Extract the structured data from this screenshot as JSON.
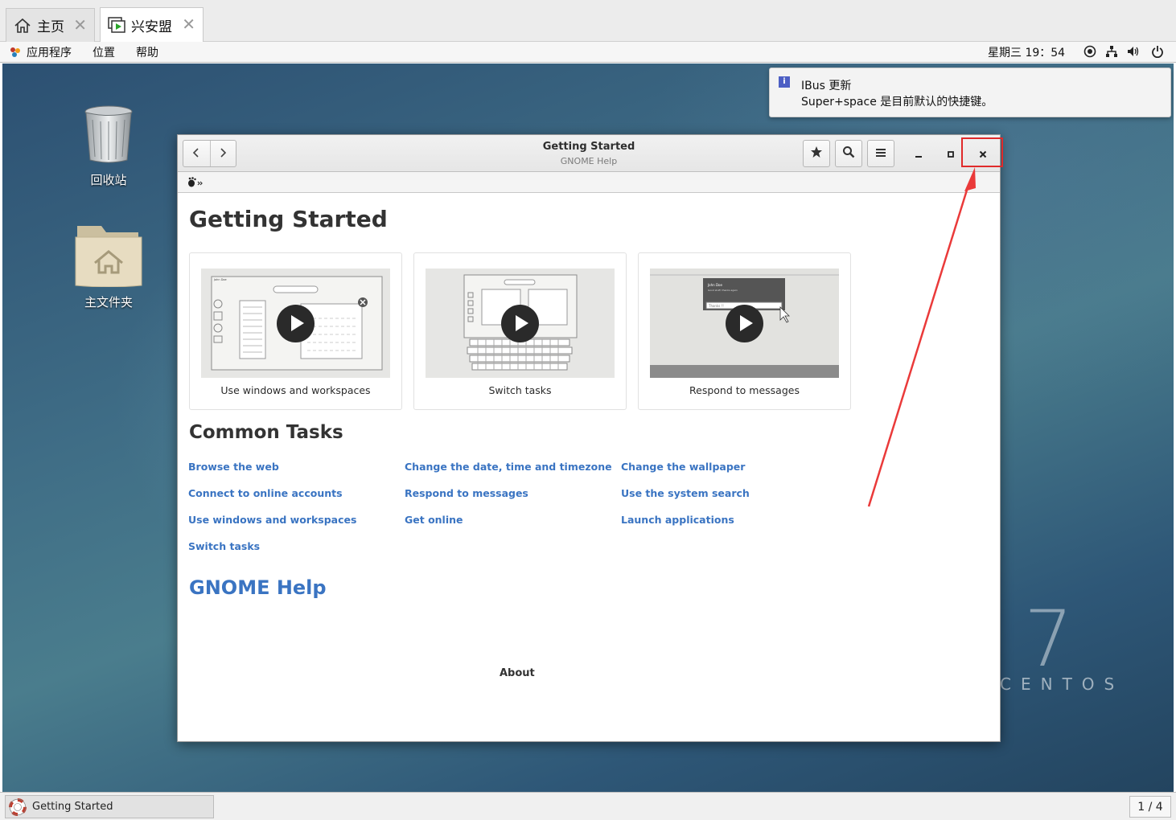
{
  "vm_tabs": [
    {
      "label": "主页",
      "icon": "home-icon",
      "active": false
    },
    {
      "label": "兴安盟",
      "icon": "vm-icon",
      "active": true
    }
  ],
  "topbar": {
    "menus": [
      "应用程序",
      "位置",
      "帮助"
    ],
    "clock": "星期三 19：54",
    "tray_icons": [
      "accessibility-icon",
      "network-icon",
      "volume-icon",
      "power-icon"
    ]
  },
  "desktop": {
    "icons": [
      {
        "label": "回收站",
        "icon": "trash-icon"
      },
      {
        "label": "主文件夹",
        "icon": "home-folder-icon"
      }
    ],
    "watermark_number": "7",
    "watermark_text": "CENTOS"
  },
  "notification": {
    "title": "IBus 更新",
    "body": "Super+space 是目前默认的快捷键。"
  },
  "window": {
    "title": "Getting Started",
    "subtitle": "GNOME Help",
    "heading": "Getting Started",
    "cards": [
      {
        "label": "Use windows and workspaces"
      },
      {
        "label": "Switch tasks"
      },
      {
        "label": "Respond to messages"
      }
    ],
    "tasks_heading": "Common Tasks",
    "tasks": [
      [
        "Browse the web",
        "Connect to online accounts",
        "Use windows and workspaces",
        "Switch tasks"
      ],
      [
        "Change the date, time and timezone",
        "Respond to messages",
        "Get online"
      ],
      [
        "Change the wallpaper",
        "Use the system search",
        "Launch applications"
      ]
    ],
    "help_link": "GNOME Help",
    "about": "About",
    "thumb_text": {
      "user": "John Doe",
      "message": "Good stuff, thanks again",
      "reply": "Thanks !!"
    }
  },
  "taskbar": {
    "item": "Getting Started",
    "workspace": "1 / 4"
  },
  "colors": {
    "link": "#3a74c2",
    "highlight": "#e02a2a"
  }
}
